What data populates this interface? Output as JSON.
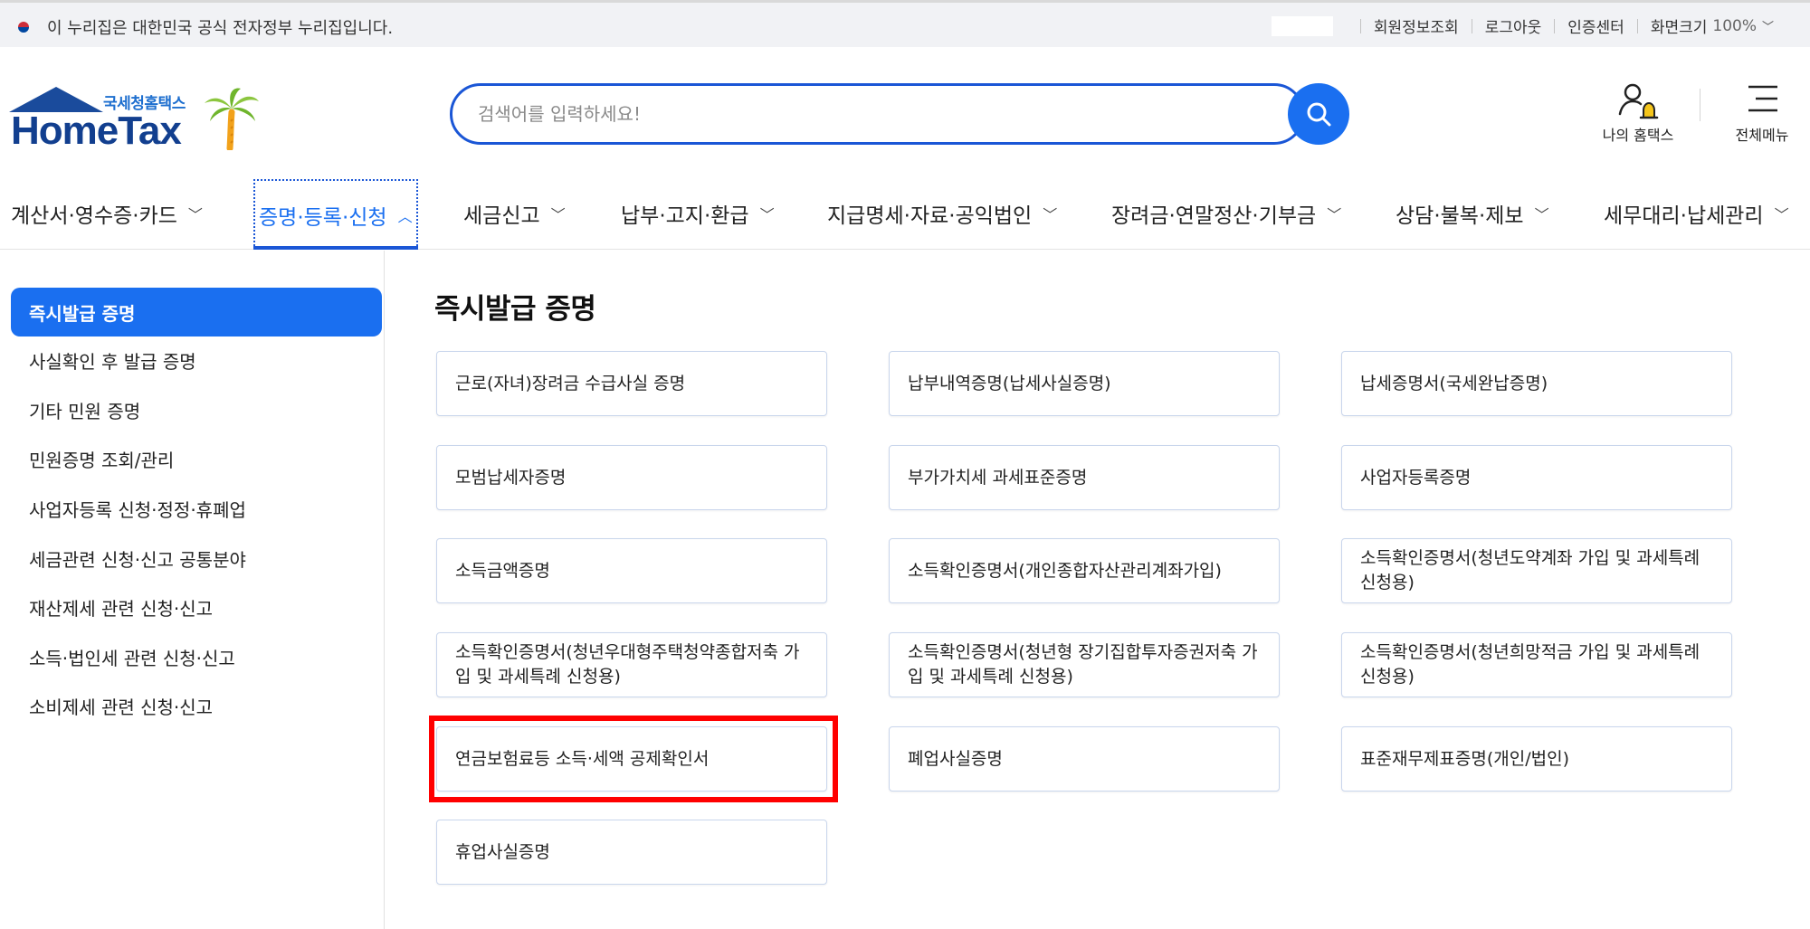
{
  "gov_bar": {
    "notice": "이 누리집은 대한민국 공식 전자정부 누리집입니다.",
    "links": [
      "회원정보조회",
      "로그아웃",
      "인증센터",
      "화면크기"
    ],
    "zoom": "100%"
  },
  "logo": {
    "sub": "국세청홈택스",
    "main": "HomeTax"
  },
  "search": {
    "placeholder": "검색어를 입력하세요!"
  },
  "header": {
    "my_hometax": "나의 홈택스",
    "all_menu": "전체메뉴"
  },
  "gnb": [
    "계산서·영수증·카드",
    "증명·등록·신청",
    "세금신고",
    "납부·고지·환급",
    "지급명세·자료·공익법인",
    "장려금·연말정산·기부금",
    "상담·불복·제보",
    "세무대리·납세관리"
  ],
  "sidebar": [
    "즉시발급 증명",
    "사실확인 후 발급 증명",
    "기타 민원 증명",
    "민원증명 조회/관리",
    "사업자등록 신청·정정·휴폐업",
    "세금관련 신청·신고 공통분야",
    "재산제세 관련 신청·신고",
    "소득·법인세 관련 신청·신고",
    "소비제세 관련 신청·신고"
  ],
  "main": {
    "title": "즉시발급 증명",
    "cards": [
      "근로(자녀)장려금 수급사실 증명",
      "납부내역증명(납세사실증명)",
      "납세증명서(국세완납증명)",
      "모범납세자증명",
      "부가가치세 과세표준증명",
      "사업자등록증명",
      "소득금액증명",
      "소득확인증명서(개인종합자산관리계좌가입)",
      "소득확인증명서(청년도약계좌 가입 및 과세특례 신청용)",
      "소득확인증명서(청년우대형주택청약종합저축 가입 및 과세특례 신청용)",
      "소득확인증명서(청년형 장기집합투자증권저축 가입 및 과세특례 신청용)",
      "소득확인증명서(청년희망적금 가입 및 과세특례 신청용)",
      "연금보험료등 소득·세액 공제확인서",
      "폐업사실증명",
      "표준재무제표증명(개인/법인)",
      "휴업사실증명"
    ]
  },
  "colors": {
    "accent": "#1a6ff0",
    "highlight": "#ff0000",
    "logo": "#123f8f"
  }
}
